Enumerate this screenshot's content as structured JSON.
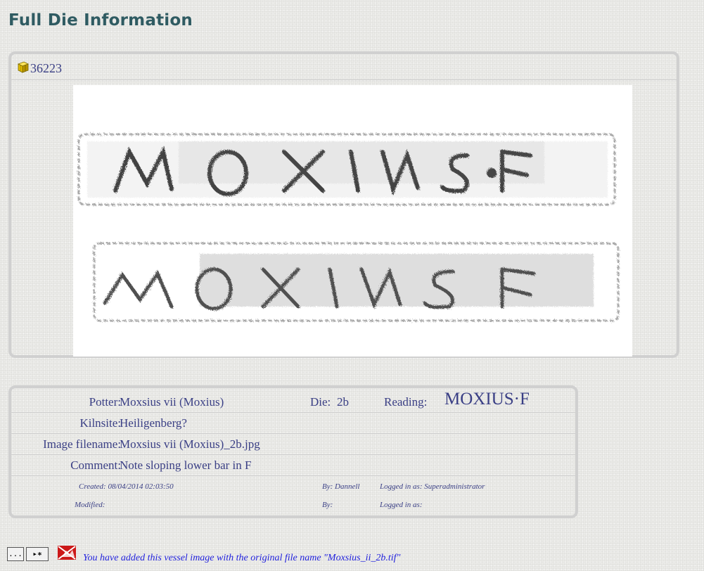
{
  "page": {
    "title": "Full Die Information"
  },
  "die": {
    "id": "36223"
  },
  "details": {
    "potter_label": "Potter:",
    "potter": "Moxsius vii (Moxius)",
    "die_label": "Die:",
    "die": "2b",
    "reading_label": "Reading:",
    "reading": "MOXIUS·F",
    "kilnsite_label": "Kilnsite:",
    "kilnsite": "Heiligenberg?",
    "filename_label": "Image filename:",
    "filename": "Moxsius vii (Moxius)_2b.jpg",
    "comment_label": "Comment:",
    "comment": "Note sloping lower bar in F",
    "created": "Created: 08/04/2014 02:03:50",
    "created_by": "By: Dannell",
    "created_logged": "Logged in as: Superadministrator",
    "modified": "Modified:",
    "modified_by": "By:",
    "modified_logged": "Logged in as:"
  },
  "toolbar": {
    "more_label": "...",
    "next_label": "▸∗",
    "notice": "You have added this vessel image with the original file name \"Moxsius_ii_2b.tif\""
  },
  "icons": [
    "cube-icon",
    "more-icon",
    "next-record-icon",
    "delete-image-icon"
  ]
}
